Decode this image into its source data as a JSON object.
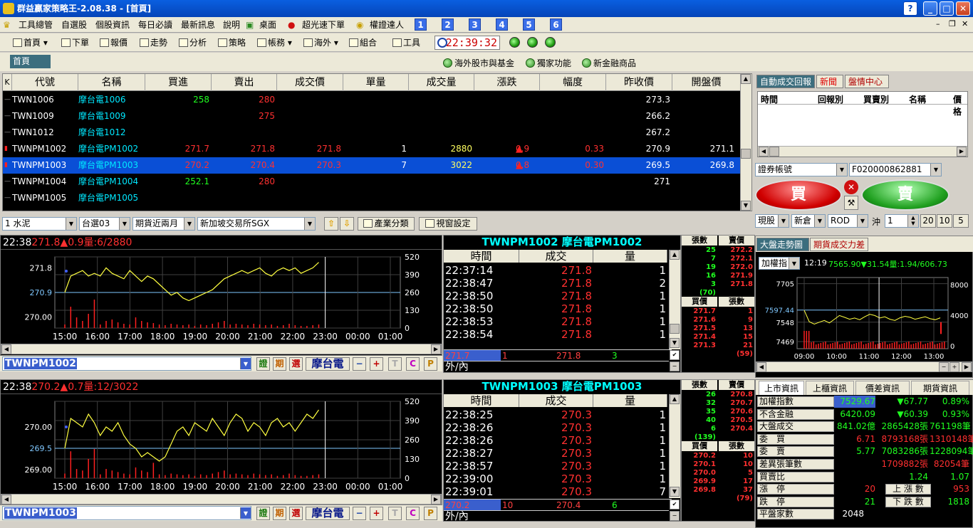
{
  "window": {
    "title": "群益贏家策略王-2.08.38 - [首頁]"
  },
  "menu": {
    "items": [
      "工具總管",
      "自選股",
      "個股資訊",
      "每日必讀",
      "最新訊息",
      "說明",
      "桌面",
      "超光速下單",
      "權證達人"
    ],
    "numbers": [
      "1",
      "2",
      "3",
      "4",
      "5",
      "6"
    ]
  },
  "toolbar": {
    "items": [
      "首頁",
      "下單",
      "報價",
      "走勢",
      "分析",
      "策略",
      "帳務",
      "海外",
      "組合",
      "工具"
    ],
    "clock": "22:39:32"
  },
  "toolbar2": {
    "home_tab": "首頁",
    "links": [
      "海外股市與基金",
      "獨家功能",
      "新金融商品"
    ]
  },
  "quote_table": {
    "k_label": "K",
    "headers": [
      "代號",
      "名稱",
      "買進",
      "賣出",
      "成交價",
      "單量",
      "成交量",
      "漲跌",
      "幅度",
      "昨收價",
      "開盤價"
    ],
    "rows": [
      {
        "code": "TWN1006",
        "name": "摩台電1006",
        "bid": "258",
        "ask": "280",
        "last": "",
        "vol": "",
        "total": "",
        "chg": "",
        "pct": "",
        "prev": "273.3",
        "open": "",
        "selected": false
      },
      {
        "code": "TWN1009",
        "name": "摩台電1009",
        "bid": "",
        "ask": "275",
        "last": "",
        "vol": "",
        "total": "",
        "chg": "",
        "pct": "",
        "prev": "266.2",
        "open": "",
        "selected": false
      },
      {
        "code": "TWN1012",
        "name": "摩台電1012",
        "bid": "",
        "ask": "",
        "last": "",
        "vol": "",
        "total": "",
        "chg": "",
        "pct": "",
        "prev": "267.2",
        "open": "",
        "selected": false
      },
      {
        "code": "TWNPM1002",
        "name": "摩台電PM1002",
        "bid": "271.7",
        "ask": "271.8",
        "last": "271.8",
        "vol": "1",
        "total": "2880",
        "chg": "0.9",
        "pct": "0.33",
        "prev": "270.9",
        "open": "271.1",
        "selected": false
      },
      {
        "code": "TWNPM1003",
        "name": "摩台電PM1003",
        "bid": "270.2",
        "ask": "270.4",
        "last": "270.3",
        "vol": "7",
        "total": "3022",
        "chg": "0.8",
        "pct": "0.30",
        "prev": "269.5",
        "open": "269.8",
        "selected": true
      },
      {
        "code": "TWNPM1004",
        "name": "摩台電PM1004",
        "bid": "252.1",
        "ask": "280",
        "last": "",
        "vol": "",
        "total": "",
        "chg": "",
        "pct": "",
        "prev": "271",
        "open": "",
        "selected": false
      },
      {
        "code": "TWNPM1005",
        "name": "摩台電PM1005",
        "bid": "",
        "ask": "",
        "last": "",
        "vol": "",
        "total": "",
        "chg": "",
        "pct": "",
        "prev": "",
        "open": "",
        "selected": false
      }
    ]
  },
  "right_panel": {
    "tabs": [
      "自動成交回報",
      "新聞",
      "盤情中心"
    ],
    "list_headers": [
      "時間",
      "回報別",
      "買賣別",
      "名稱",
      "價格"
    ],
    "account_label": "證券帳號",
    "account_value": "F020000862881",
    "buy_label": "買",
    "sell_label": "賣",
    "order_type": "現股",
    "position": "新倉",
    "tif": "ROD",
    "offset_label": "沖",
    "qty": "1",
    "lots": [
      "20",
      "10",
      "5"
    ]
  },
  "filter_bar": {
    "sector": "1 水泥",
    "group": "台選03",
    "futures": "期貨近兩月",
    "exchange": "新加坡交易所SGX",
    "industry_btn": "產業分類",
    "window_btn": "視窗設定"
  },
  "chart1": {
    "header_time": "22:38",
    "header_quote": "271.8▲0.9量:6/2880",
    "symbol": "TWNPM1002",
    "y_left": [
      "271.8",
      "270.9",
      "270.00"
    ],
    "y_right": [
      "520",
      "390",
      "260",
      "130",
      "0"
    ],
    "x_labels": [
      "15:00",
      "16:00",
      "17:00",
      "18:00",
      "19:00",
      "20:00",
      "21:00",
      "22:00",
      "23:00",
      "00:00",
      "01:00"
    ],
    "series": [
      270.9,
      271.5,
      271.6,
      271.7,
      271.5,
      271.6,
      271.5,
      271.8,
      271.6,
      271.5,
      271.4,
      271.7,
      271.5,
      271.3,
      271.5,
      271.4,
      271.2,
      271.0,
      270.8,
      270.9,
      270.7,
      270.6,
      270.7,
      270.8,
      270.9,
      271.0,
      271.2,
      271.4,
      271.5,
      271.6,
      271.7,
      271.6,
      271.7,
      271.8,
      271.6,
      271.5,
      271.7,
      271.8,
      271.7,
      271.8,
      271.6,
      271.7,
      271.8,
      272.0
    ],
    "volume_bars": [
      0.05,
      0.3,
      0.15,
      0.1,
      0.2,
      0.4,
      0.05,
      0.1,
      0.12,
      0.08,
      0.06,
      0.05,
      0.15,
      0.1,
      0.08,
      0.07,
      0.05,
      0.04,
      0.06,
      0.05,
      0.04,
      0.05,
      0.03,
      0.05,
      0.04,
      0.06,
      0.08,
      0.1,
      0.05,
      0.06,
      0.05,
      0.04,
      0.06,
      0.05,
      0.04,
      0.05,
      0.03,
      0.04,
      0.06,
      0.04,
      0.03,
      0.03,
      0.04,
      0.05
    ],
    "ylim": [
      269.6,
      272.2
    ]
  },
  "chart2": {
    "header_time": "22:38",
    "header_quote": "270.2▲0.7量:12/3022",
    "symbol": "TWNPM1003",
    "y_left": [
      "270.00",
      "269.5",
      "269.00"
    ],
    "y_right": [
      "520",
      "390",
      "260",
      "130",
      "0"
    ],
    "x_labels": [
      "15:00",
      "16:00",
      "17:00",
      "18:00",
      "19:00",
      "20:00",
      "21:00",
      "22:00",
      "23:00",
      "00:00",
      "01:00"
    ],
    "series": [
      269.5,
      270.2,
      270.1,
      270.0,
      270.3,
      270.1,
      269.8,
      270.0,
      269.9,
      270.1,
      269.8,
      269.6,
      269.5,
      269.3,
      269.4,
      269.3,
      269.2,
      269.3,
      269.6,
      269.9,
      270.0,
      269.8,
      270.1,
      270.0,
      269.9,
      270.2,
      270.0,
      269.8,
      270.1,
      270.3,
      270.2,
      269.9,
      270.1,
      270.0,
      269.8,
      270.1,
      270.2,
      270.0,
      270.1,
      269.9,
      270.1,
      270.3,
      270.2,
      270.4
    ],
    "volume_bars": [
      0.06,
      0.35,
      0.12,
      0.1,
      0.25,
      0.38,
      0.05,
      0.12,
      0.1,
      0.08,
      0.06,
      0.05,
      0.14,
      0.1,
      0.08,
      0.2,
      0.05,
      0.04,
      0.06,
      0.05,
      0.04,
      0.05,
      0.03,
      0.05,
      0.04,
      0.06,
      0.08,
      0.1,
      0.05,
      0.06,
      0.05,
      0.04,
      0.06,
      0.05,
      0.04,
      0.05,
      0.03,
      0.04,
      0.06,
      0.04,
      0.03,
      0.03,
      0.04,
      0.05
    ],
    "ylim": [
      268.8,
      270.6
    ]
  },
  "ticks1": {
    "title": "TWNPM1002 摩台電PM1002",
    "headers": [
      "時間",
      "成交",
      "量"
    ],
    "rows": [
      [
        "22:37:14",
        "271.8",
        "1"
      ],
      [
        "22:38:47",
        "271.8",
        "2"
      ],
      [
        "22:38:50",
        "271.8",
        "1"
      ],
      [
        "22:38:50",
        "271.8",
        "1"
      ],
      [
        "22:38:53",
        "271.8",
        "1"
      ],
      [
        "22:38:54",
        "271.8",
        "1"
      ]
    ],
    "summary": [
      "271.7",
      "1",
      "271.8",
      "3"
    ],
    "outin": "外/內"
  },
  "ticks2": {
    "title": "TWNPM1003 摩台電PM1003",
    "headers": [
      "時間",
      "成交",
      "量"
    ],
    "rows": [
      [
        "22:38:25",
        "270.3",
        "1"
      ],
      [
        "22:38:26",
        "270.3",
        "1"
      ],
      [
        "22:38:26",
        "270.3",
        "1"
      ],
      [
        "22:38:27",
        "270.3",
        "1"
      ],
      [
        "22:38:57",
        "270.3",
        "1"
      ],
      [
        "22:39:00",
        "270.3",
        "1"
      ],
      [
        "22:39:01",
        "270.3",
        "7"
      ]
    ],
    "summary": [
      "270.2",
      "10",
      "270.4",
      "6"
    ],
    "outin": "外/內"
  },
  "depth1": {
    "ask_headers": [
      "張數",
      "賣價"
    ],
    "asks": [
      [
        "25",
        "272.2"
      ],
      [
        "7",
        "272.1"
      ],
      [
        "19",
        "272.0"
      ],
      [
        "16",
        "271.9"
      ],
      [
        "3",
        "271.8"
      ]
    ],
    "ask_total": "(70)",
    "bid_headers": [
      "買價",
      "張數"
    ],
    "bids": [
      [
        "271.7",
        "1"
      ],
      [
        "271.6",
        "9"
      ],
      [
        "271.5",
        "13"
      ],
      [
        "271.4",
        "15"
      ],
      [
        "271.3",
        "21"
      ]
    ],
    "bid_total": "(59)"
  },
  "depth2": {
    "ask_headers": [
      "張數",
      "賣價"
    ],
    "asks": [
      [
        "26",
        "270.8"
      ],
      [
        "32",
        "270.7"
      ],
      [
        "35",
        "270.6"
      ],
      [
        "40",
        "270.5"
      ],
      [
        "6",
        "270.4"
      ]
    ],
    "ask_total": "(139)",
    "bid_headers": [
      "買價",
      "張數"
    ],
    "bids": [
      [
        "270.2",
        "10"
      ],
      [
        "270.1",
        "10"
      ],
      [
        "270.0",
        "5"
      ],
      [
        "269.9",
        "17"
      ],
      [
        "269.8",
        "37"
      ]
    ],
    "bid_total": "(79)"
  },
  "index_chart": {
    "tabs": [
      "大盤走勢圖",
      "期貨成交力差"
    ],
    "index_select": "加權指",
    "time": "12:19",
    "quote": "7565.90▼31.54量:1.94/606.73",
    "y_left": [
      "7705",
      "7597.44",
      "7548",
      "7469"
    ],
    "y_right": [
      "8000",
      "4000",
      "0"
    ],
    "x_labels": [
      "09:00",
      "10:00",
      "11:00",
      "12:00",
      "13:00"
    ],
    "series": [
      7597,
      7550,
      7540,
      7548,
      7555,
      7545,
      7560,
      7575,
      7568,
      7560,
      7565,
      7558,
      7570,
      7580,
      7575,
      7565,
      7570,
      7560,
      7555,
      7566,
      7572,
      7568,
      7560,
      7565,
      7570,
      7562,
      7558,
      7566
    ],
    "ylim": [
      7440,
      7730
    ]
  },
  "market_info": {
    "tabs": [
      "上市資訊",
      "上櫃資訊",
      "價差資訊",
      "期貨資訊"
    ],
    "rows": [
      {
        "label": "加權指數",
        "v1": "7529.67",
        "v2": "▼67.77",
        "v3": "0.89%"
      },
      {
        "label": "不含金融",
        "v1": "6420.09",
        "v2": "▼60.39",
        "v3": "0.93%"
      },
      {
        "label": "大盤成交",
        "v1": "841.02億",
        "v2": "2865428張",
        "v3": "761198筆"
      },
      {
        "label": "委　買",
        "v1": "6.71",
        "v2": "8793168張",
        "v3": "1310148筆"
      },
      {
        "label": "委　賣",
        "v1": "5.77",
        "v2": "7083286張",
        "v3": "1228094筆"
      },
      {
        "label": "差異張筆數",
        "v1": "",
        "v2": "1709882張",
        "v3": "82054筆"
      },
      {
        "label": "買賣比",
        "v1": "",
        "v2": "1.24",
        "v3": "1.07"
      },
      {
        "label": "漲　停",
        "v1": "20",
        "v2": "上 漲 數",
        "v3": "953"
      },
      {
        "label": "跌　停",
        "v1": "21",
        "v2": "下 跌 數",
        "v3": "1818"
      },
      {
        "label": "平盤家數",
        "v1": "2048",
        "v2": "",
        "v3": ""
      }
    ]
  },
  "colors": {
    "up": "#ff3030",
    "down": "#20ff20",
    "cyan": "#00ffff",
    "yellow": "#ffff40",
    "select": "#0a4fd6"
  }
}
